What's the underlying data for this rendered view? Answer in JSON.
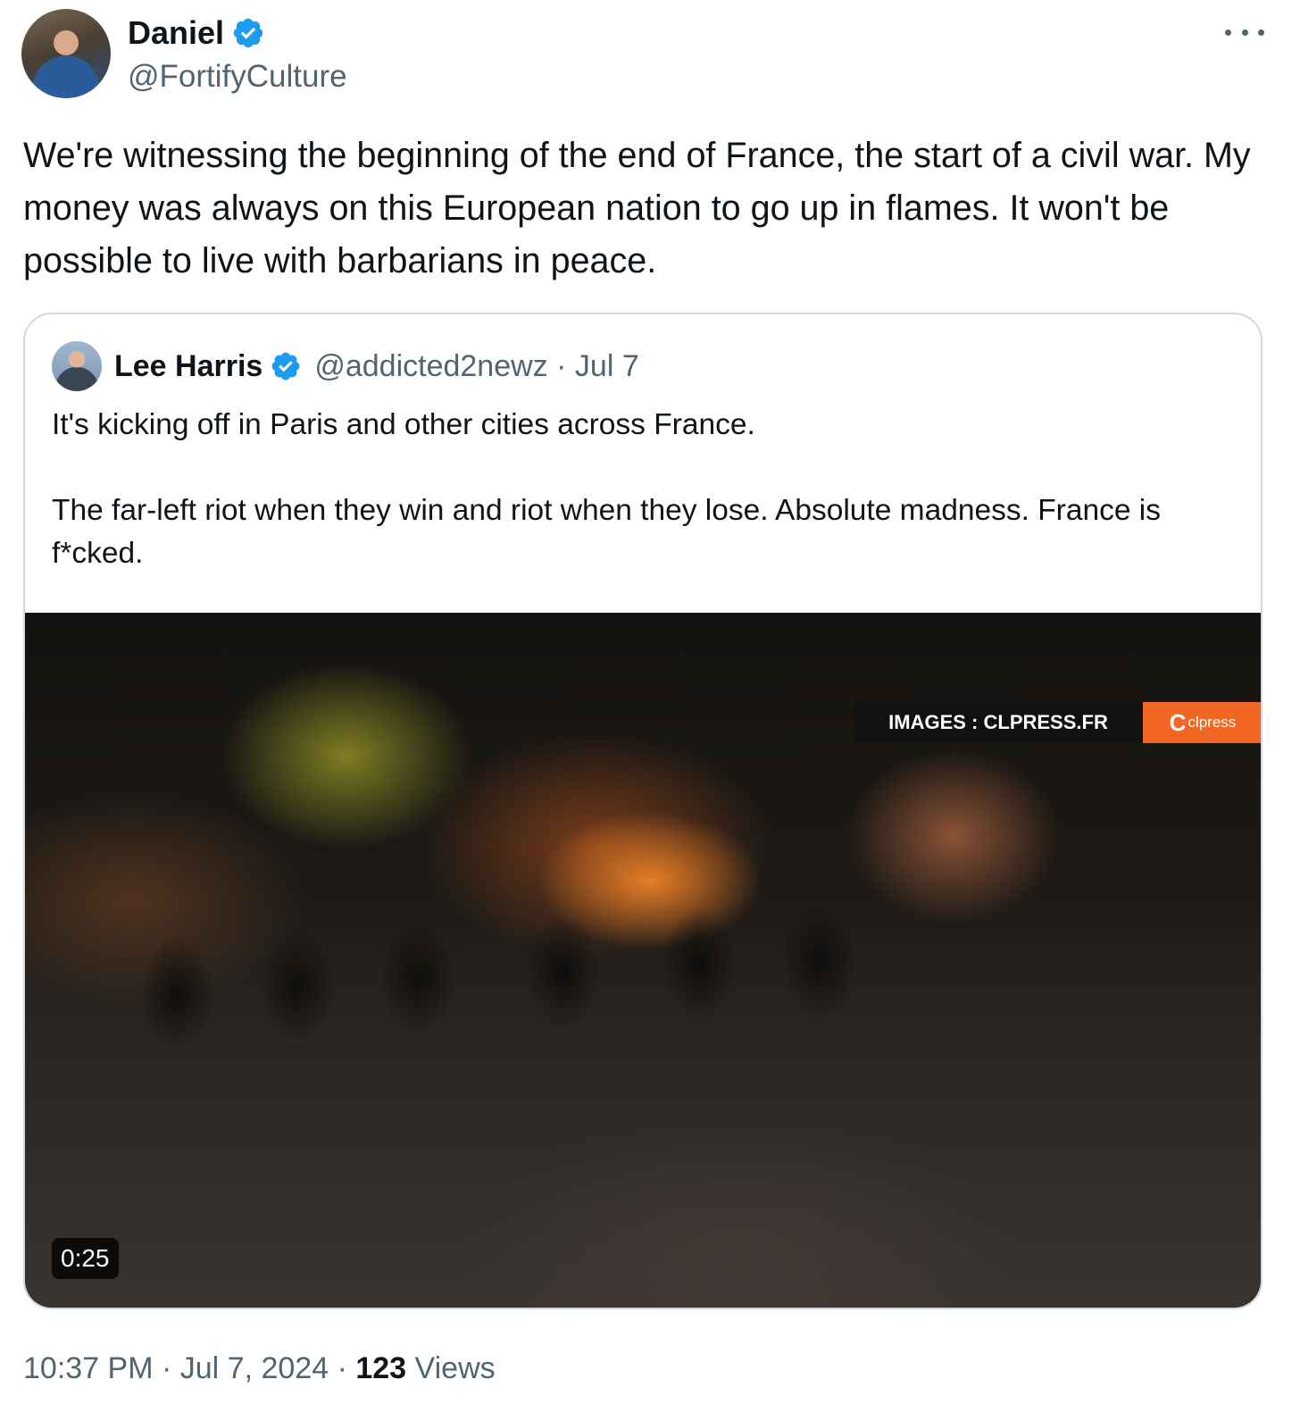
{
  "author": {
    "name": "Daniel",
    "handle": "@FortifyCulture",
    "verified_icon": "verified-badge-icon"
  },
  "tweet": {
    "text": "We're witnessing the beginning of the end of France, the start of a civil war. My money was always on this European nation to go up in flames. It won't be possible to live with barbarians in peace."
  },
  "quote": {
    "name": "Lee Harris",
    "handle": "@addicted2newz",
    "separator": "·",
    "date": "Jul 7",
    "text": "It's kicking off in Paris and other cities across France.\n\nThe far-left riot when they win and riot when they lose. Absolute madness. France is f*cked.",
    "media": {
      "watermark_text": "IMAGES : CLPRESS.FR",
      "watermark_logo": "clpress",
      "watermark_logo_letter": "C",
      "duration": "0:25"
    }
  },
  "footer": {
    "time": "10:37 PM",
    "separator": "·",
    "date": "Jul 7, 2024",
    "views_count": "123",
    "views_label": "Views"
  },
  "colors": {
    "verified": "#1d9bf0",
    "secondary_text": "#536471",
    "primary_text": "#0f1419",
    "border": "#cfd9de",
    "watermark_orange": "#f26522"
  }
}
